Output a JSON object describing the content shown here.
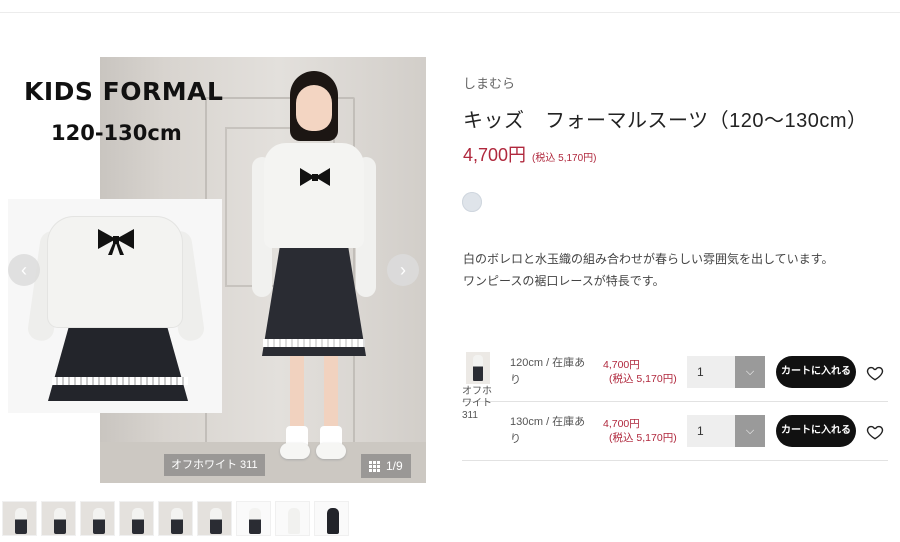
{
  "gallery": {
    "overlay_title": "KIDS FORMAL",
    "overlay_size": "120-130cm",
    "color_label": "オフホワイト 311",
    "counter": "1/9",
    "prev_icon": "chevron-left-icon",
    "next_icon": "chevron-right-icon",
    "prev_glyph": "‹",
    "next_glyph": "›",
    "thumbnail_count": 9
  },
  "product": {
    "brand": "しまむら",
    "title": "キッズ　フォーマルスーツ（120～130cm）",
    "price": "4,700円",
    "price_tax": "(税込 5,170円)",
    "swatch_color": "#dfe4ea",
    "description": [
      "白のボレロと水玉織の組み合わせが春らしい雰囲気を出しています。",
      "ワンピースの裾口レースが特長です。"
    ]
  },
  "variants": {
    "color_name": "オフホワイト 311",
    "rows": [
      {
        "size": "120cm / 在庫あり",
        "price": "4,700円",
        "price_tax": "(税込 5,170円)",
        "qty": "1",
        "cart_label": "カートに入れる"
      },
      {
        "size": "130cm / 在庫あり",
        "price": "4,700円",
        "price_tax": "(税込 5,170円)",
        "qty": "1",
        "cart_label": "カートに入れる"
      }
    ]
  },
  "colors": {
    "accent_price": "#b0283d",
    "cart_button": "#111111"
  }
}
